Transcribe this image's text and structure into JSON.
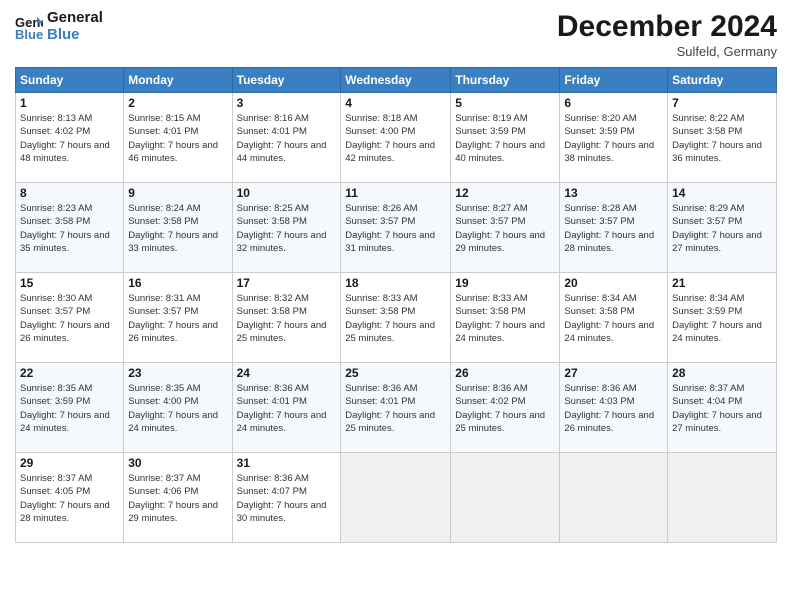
{
  "logo": {
    "line1": "General",
    "line2": "Blue"
  },
  "title": "December 2024",
  "subtitle": "Sulfeld, Germany",
  "days_header": [
    "Sunday",
    "Monday",
    "Tuesday",
    "Wednesday",
    "Thursday",
    "Friday",
    "Saturday"
  ],
  "weeks": [
    [
      {
        "day": "1",
        "rise": "8:13 AM",
        "set": "4:02 PM",
        "daylight": "7 hours and 48 minutes."
      },
      {
        "day": "2",
        "rise": "8:15 AM",
        "set": "4:01 PM",
        "daylight": "7 hours and 46 minutes."
      },
      {
        "day": "3",
        "rise": "8:16 AM",
        "set": "4:01 PM",
        "daylight": "7 hours and 44 minutes."
      },
      {
        "day": "4",
        "rise": "8:18 AM",
        "set": "4:00 PM",
        "daylight": "7 hours and 42 minutes."
      },
      {
        "day": "5",
        "rise": "8:19 AM",
        "set": "3:59 PM",
        "daylight": "7 hours and 40 minutes."
      },
      {
        "day": "6",
        "rise": "8:20 AM",
        "set": "3:59 PM",
        "daylight": "7 hours and 38 minutes."
      },
      {
        "day": "7",
        "rise": "8:22 AM",
        "set": "3:58 PM",
        "daylight": "7 hours and 36 minutes."
      }
    ],
    [
      {
        "day": "8",
        "rise": "8:23 AM",
        "set": "3:58 PM",
        "daylight": "7 hours and 35 minutes."
      },
      {
        "day": "9",
        "rise": "8:24 AM",
        "set": "3:58 PM",
        "daylight": "7 hours and 33 minutes."
      },
      {
        "day": "10",
        "rise": "8:25 AM",
        "set": "3:58 PM",
        "daylight": "7 hours and 32 minutes."
      },
      {
        "day": "11",
        "rise": "8:26 AM",
        "set": "3:57 PM",
        "daylight": "7 hours and 31 minutes."
      },
      {
        "day": "12",
        "rise": "8:27 AM",
        "set": "3:57 PM",
        "daylight": "7 hours and 29 minutes."
      },
      {
        "day": "13",
        "rise": "8:28 AM",
        "set": "3:57 PM",
        "daylight": "7 hours and 28 minutes."
      },
      {
        "day": "14",
        "rise": "8:29 AM",
        "set": "3:57 PM",
        "daylight": "7 hours and 27 minutes."
      }
    ],
    [
      {
        "day": "15",
        "rise": "8:30 AM",
        "set": "3:57 PM",
        "daylight": "7 hours and 26 minutes."
      },
      {
        "day": "16",
        "rise": "8:31 AM",
        "set": "3:57 PM",
        "daylight": "7 hours and 26 minutes."
      },
      {
        "day": "17",
        "rise": "8:32 AM",
        "set": "3:58 PM",
        "daylight": "7 hours and 25 minutes."
      },
      {
        "day": "18",
        "rise": "8:33 AM",
        "set": "3:58 PM",
        "daylight": "7 hours and 25 minutes."
      },
      {
        "day": "19",
        "rise": "8:33 AM",
        "set": "3:58 PM",
        "daylight": "7 hours and 24 minutes."
      },
      {
        "day": "20",
        "rise": "8:34 AM",
        "set": "3:58 PM",
        "daylight": "7 hours and 24 minutes."
      },
      {
        "day": "21",
        "rise": "8:34 AM",
        "set": "3:59 PM",
        "daylight": "7 hours and 24 minutes."
      }
    ],
    [
      {
        "day": "22",
        "rise": "8:35 AM",
        "set": "3:59 PM",
        "daylight": "7 hours and 24 minutes."
      },
      {
        "day": "23",
        "rise": "8:35 AM",
        "set": "4:00 PM",
        "daylight": "7 hours and 24 minutes."
      },
      {
        "day": "24",
        "rise": "8:36 AM",
        "set": "4:01 PM",
        "daylight": "7 hours and 24 minutes."
      },
      {
        "day": "25",
        "rise": "8:36 AM",
        "set": "4:01 PM",
        "daylight": "7 hours and 25 minutes."
      },
      {
        "day": "26",
        "rise": "8:36 AM",
        "set": "4:02 PM",
        "daylight": "7 hours and 25 minutes."
      },
      {
        "day": "27",
        "rise": "8:36 AM",
        "set": "4:03 PM",
        "daylight": "7 hours and 26 minutes."
      },
      {
        "day": "28",
        "rise": "8:37 AM",
        "set": "4:04 PM",
        "daylight": "7 hours and 27 minutes."
      }
    ],
    [
      {
        "day": "29",
        "rise": "8:37 AM",
        "set": "4:05 PM",
        "daylight": "7 hours and 28 minutes."
      },
      {
        "day": "30",
        "rise": "8:37 AM",
        "set": "4:06 PM",
        "daylight": "7 hours and 29 minutes."
      },
      {
        "day": "31",
        "rise": "8:36 AM",
        "set": "4:07 PM",
        "daylight": "7 hours and 30 minutes."
      },
      null,
      null,
      null,
      null
    ]
  ]
}
